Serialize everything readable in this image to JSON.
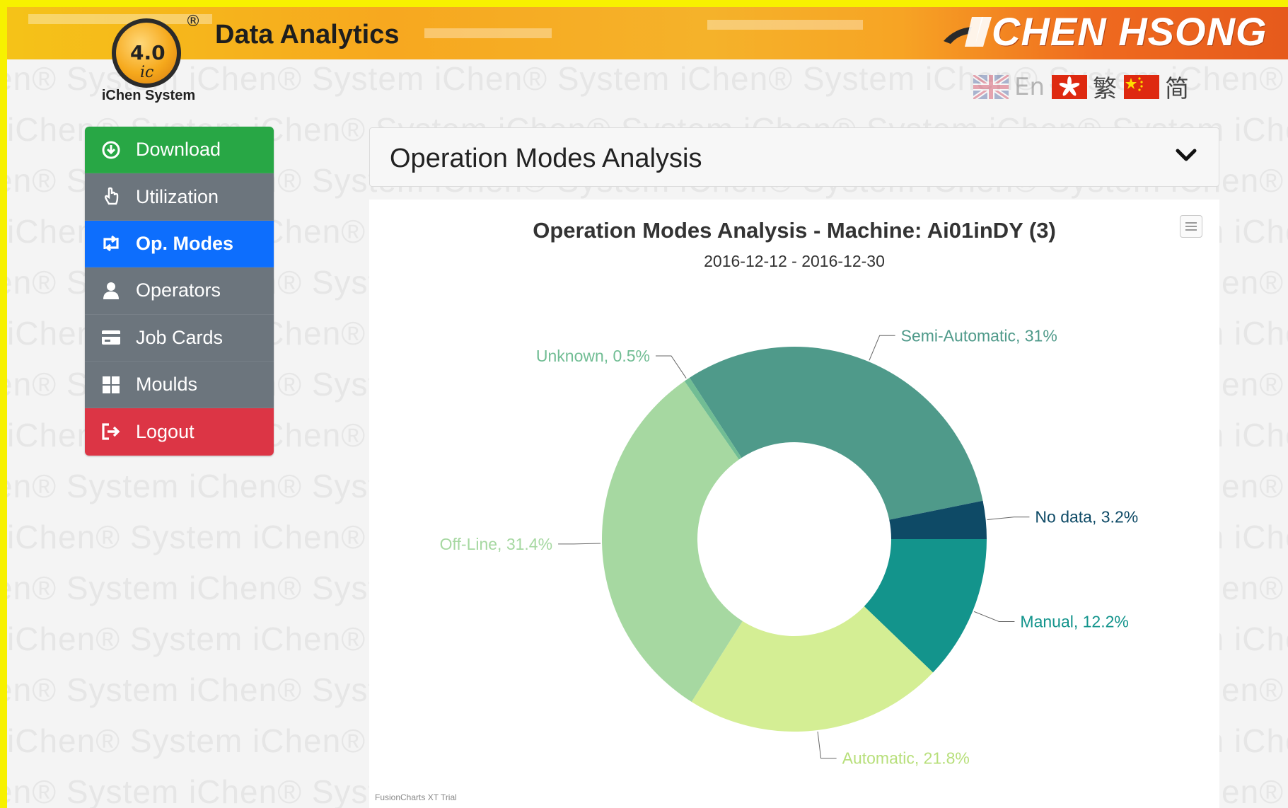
{
  "header": {
    "app_title": "Data Analytics",
    "logo_number": "4.0",
    "logo_ic": "ic",
    "logo_registered": "®",
    "logo_caption": "iChen System",
    "brand": "CHEN HSONG"
  },
  "watermark_text": "iChen® System",
  "language": {
    "en_label": "En",
    "trad_label": "繁",
    "simp_label": "简"
  },
  "sidebar": {
    "items": [
      {
        "label": "Download",
        "icon": "download-icon"
      },
      {
        "label": "Utilization",
        "icon": "hand-pointer-icon"
      },
      {
        "label": "Op. Modes",
        "icon": "retweet-icon"
      },
      {
        "label": "Operators",
        "icon": "user-icon"
      },
      {
        "label": "Job Cards",
        "icon": "card-icon"
      },
      {
        "label": "Moulds",
        "icon": "grid-icon"
      },
      {
        "label": "Logout",
        "icon": "logout-icon"
      }
    ],
    "active": "Op. Modes"
  },
  "panel": {
    "title": "Operation Modes Analysis"
  },
  "chart_data": {
    "type": "pie",
    "donut": true,
    "title": "Operation Modes Analysis - Machine: Ai01inDY (3)",
    "subtitle": "2016-12-12 - 2016-12-30",
    "footer": "FusionCharts XT Trial",
    "slices": [
      {
        "label": "Semi-Automatic, 31%",
        "value": 31,
        "color": "#4f9a8a",
        "label_color": "#4f9a8a"
      },
      {
        "label": "No data, 3.2%",
        "value": 3.2,
        "color": "#0e4a66",
        "label_color": "#0e4a66"
      },
      {
        "label": "Manual, 12.2%",
        "value": 12.2,
        "color": "#13948c",
        "label_color": "#13948c"
      },
      {
        "label": "Automatic, 21.8%",
        "value": 21.8,
        "color": "#d4ee94",
        "label_color": "#b7df7a"
      },
      {
        "label": "Off-Line, 31.4%",
        "value": 31.4,
        "color": "#a6d8a1",
        "label_color": "#a6d8a1"
      },
      {
        "label": "Unknown, 0.5%",
        "value": 0.5,
        "color": "#71bd94",
        "label_color": "#71bd94"
      }
    ]
  }
}
